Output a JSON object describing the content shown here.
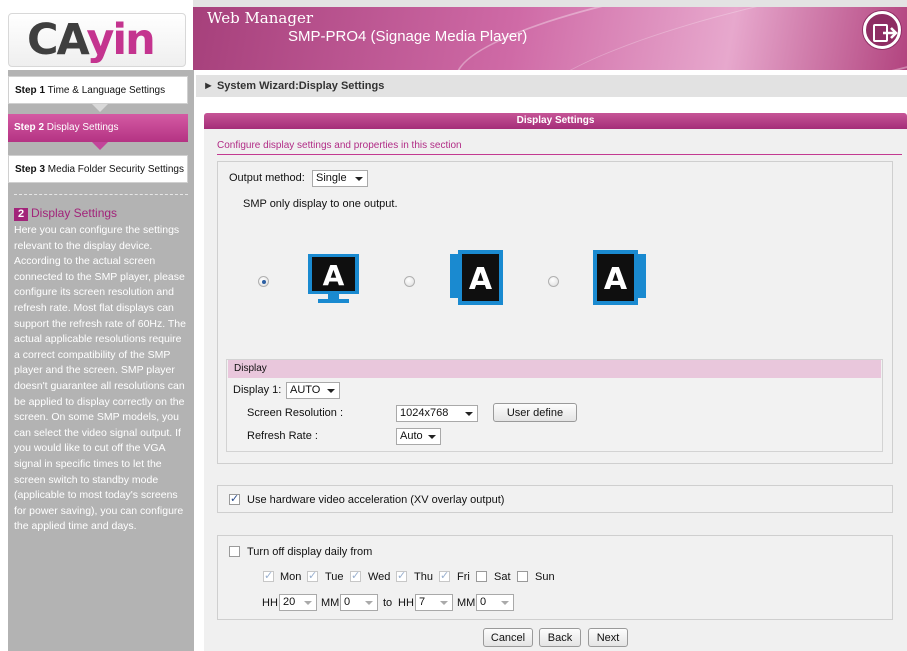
{
  "header": {
    "logo": {
      "part1": "CA",
      "part2": "yin"
    },
    "app_title": "Web Manager",
    "device_title": "SMP-PRO4 (Signage Media Player)",
    "logout_icon": "exit-icon"
  },
  "sidebar": {
    "steps": [
      {
        "prefix": "Step 1",
        "label": "Time & Language Settings"
      },
      {
        "prefix": "Step 2",
        "label": "Display Settings"
      },
      {
        "prefix": "Step 3",
        "label": "Media Folder Security Settings"
      }
    ],
    "help": {
      "number": "2",
      "heading": "Display Settings",
      "text": "Here you can configure the settings relevant to the display device. According to the actual screen connected to the SMP player, please configure its screen resolution and refresh rate. Most flat displays can support the refresh rate of 60Hz. The actual applicable resolutions require a correct compatibility of the SMP player and the screen. SMP player doesn't guarantee all resolutions can be applied to display correctly on the screen. On some SMP models, you can select the video signal output. If you would like to cut off the VGA signal in specific times to let the screen switch to standby mode (applicable to most today's screens for power saving), you can configure the applied time and days."
    }
  },
  "breadcrumb": "► System Wizard:Display Settings",
  "panel": {
    "title": "Display Settings",
    "description": "Configure display settings and properties in this section",
    "output": {
      "label": "Output method:",
      "value": "Single",
      "note": "SMP only display to one output.",
      "options": [
        {
          "glyph": "A",
          "selected": true
        },
        {
          "glyph": "A",
          "selected": false
        },
        {
          "glyph": "A",
          "selected": false
        }
      ]
    },
    "display": {
      "section_title": "Display",
      "display1_label": "Display 1:",
      "display1_value": "AUTO",
      "resolution_label": "Screen Resolution :",
      "resolution_value": "1024x768",
      "user_define_label": "User define",
      "refresh_label": "Refresh Rate :",
      "refresh_value": "Auto"
    },
    "hw_accel": {
      "label": "Use hardware video acceleration (XV overlay output)",
      "checked": true
    },
    "schedule": {
      "label": "Turn off display daily from",
      "checked": false,
      "days": [
        {
          "label": "Mon",
          "checked": true
        },
        {
          "label": "Tue",
          "checked": true
        },
        {
          "label": "Wed",
          "checked": true
        },
        {
          "label": "Thu",
          "checked": true
        },
        {
          "label": "Fri",
          "checked": true
        },
        {
          "label": "Sat",
          "checked": false
        },
        {
          "label": "Sun",
          "checked": false
        }
      ],
      "hh_label": "HH",
      "mm_label": "MM",
      "to_label": "to",
      "from_hh": "20",
      "from_mm": "0",
      "to_hh": "7",
      "to_mm": "0"
    },
    "buttons": {
      "cancel": "Cancel",
      "back": "Back",
      "next": "Next"
    }
  },
  "colors": {
    "accent": "#c4348f",
    "sidebar_bg": "#b3b3b3",
    "active_step": "#b43383"
  }
}
